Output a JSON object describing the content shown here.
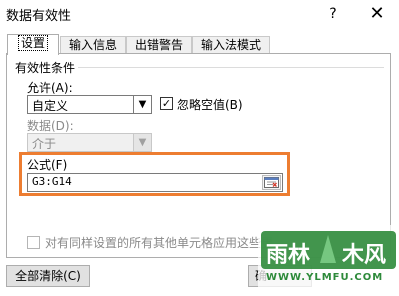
{
  "window": {
    "title": "数据有效性",
    "help_label": "?",
    "close_label": "✕"
  },
  "tabs": [
    {
      "label": "设置"
    },
    {
      "label": "输入信息"
    },
    {
      "label": "出错警告"
    },
    {
      "label": "输入法模式"
    }
  ],
  "settings": {
    "group_label": "有效性条件",
    "allow_label": "允许(A):",
    "allow_value": "自定义",
    "ignore_blank_label": "忽略空值(B)",
    "ignore_blank_checked": true,
    "data_label": "数据(D):",
    "data_value": "介于",
    "formula_label": "公式(F)",
    "formula_value": "G3:G14",
    "apply_all_label": "对有同样设置的所有其他单元格应用这些更"
  },
  "buttons": {
    "clear_all_label": "全部清除(C)",
    "ok_label": "确"
  },
  "watermark": {
    "text_main": "雨林",
    "text_tail": "木风",
    "url": "WWW.YLMFU.COM"
  },
  "colors": {
    "highlight": "#ed7d31",
    "watermark_bg": "#2d8a3a"
  },
  "icons": {
    "dropdown": "chevron-down-icon",
    "checkmark": "checkmark-icon",
    "collapse": "collapse-dialog-icon"
  }
}
